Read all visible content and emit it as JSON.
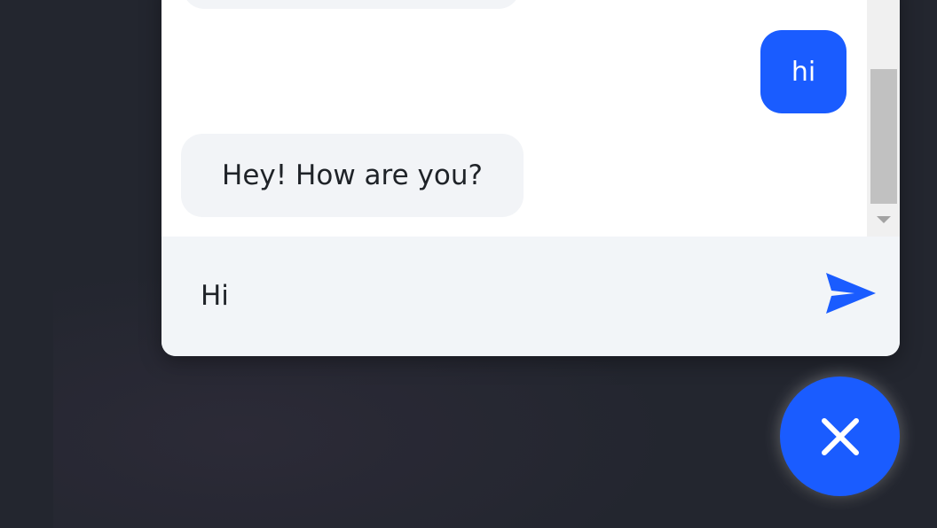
{
  "chat": {
    "messages": [
      {
        "role": "user",
        "text": "hi"
      },
      {
        "role": "bot",
        "text": "Hey! How are you?"
      }
    ],
    "input": {
      "value": "Hi"
    }
  },
  "icons": {
    "send": "send-icon",
    "close": "close-icon"
  },
  "colors": {
    "accent": "#1a5cff",
    "page_background": "#23262f",
    "bot_bubble": "#f2f4f7",
    "input_bar": "#f2f5f8"
  }
}
